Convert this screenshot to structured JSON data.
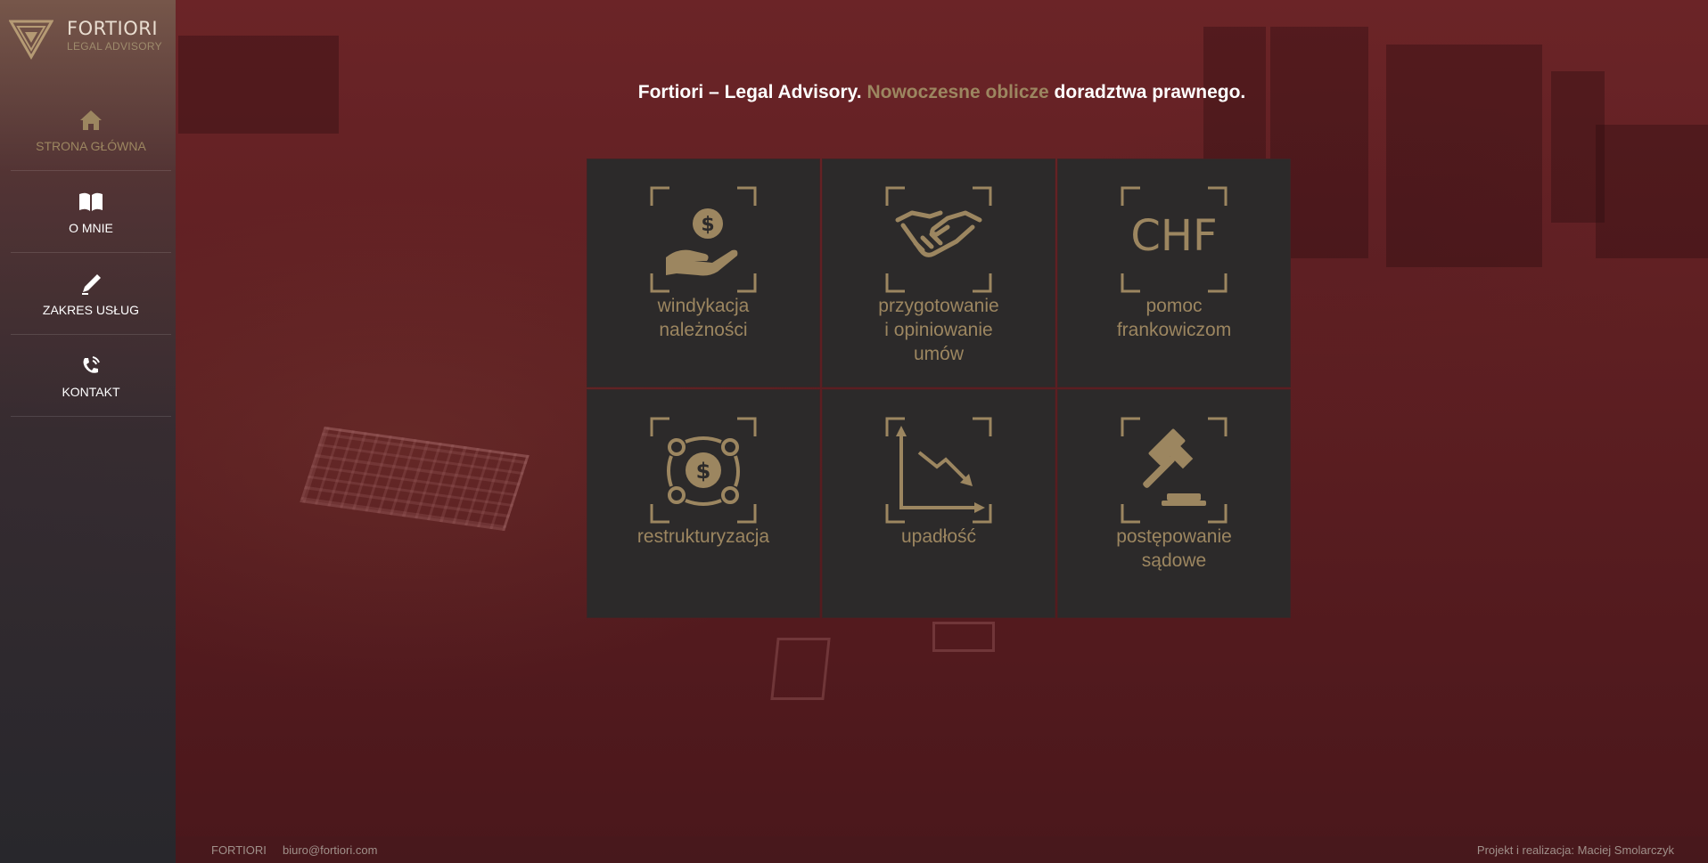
{
  "brand": {
    "name": "FORTIORI",
    "subtitle": "LEGAL ADVISORY"
  },
  "nav": {
    "items": [
      {
        "label": "STRONA GŁÓWNA",
        "icon": "home-icon",
        "active": true
      },
      {
        "label": "O MNIE",
        "icon": "book-icon",
        "active": false
      },
      {
        "label": "ZAKRES USŁUG",
        "icon": "pen-icon",
        "active": false
      },
      {
        "label": "KONTAKT",
        "icon": "phone-icon",
        "active": false
      }
    ]
  },
  "headline": {
    "part1": "Fortiori – Legal Advisory.",
    "accent": "Nowoczesne oblicze",
    "part2": "doradztwa prawnego."
  },
  "tiles": [
    {
      "label": "windykacja\nnależności",
      "icon": "hand-coin-icon"
    },
    {
      "label": "przygotowanie\ni opiniowanie\numów",
      "icon": "handshake-icon"
    },
    {
      "label": "pomoc\nfrankowiczom",
      "icon": "chf-icon",
      "icon_text": "CHF"
    },
    {
      "label": "restrukturyzacja",
      "icon": "dollar-cycle-icon"
    },
    {
      "label": "upadłość",
      "icon": "declining-chart-icon"
    },
    {
      "label": "postępowanie\nsądowe",
      "icon": "gavel-icon"
    }
  ],
  "footer": {
    "brand": "FORTIORI",
    "email": "biuro@fortiori.com",
    "credit": "Projekt i realizacja: Maciej Smolarczyk"
  },
  "colors": {
    "accent": "#9c8660",
    "tile_bg": "#2c2a2a",
    "overlay": "#5e1f22"
  }
}
